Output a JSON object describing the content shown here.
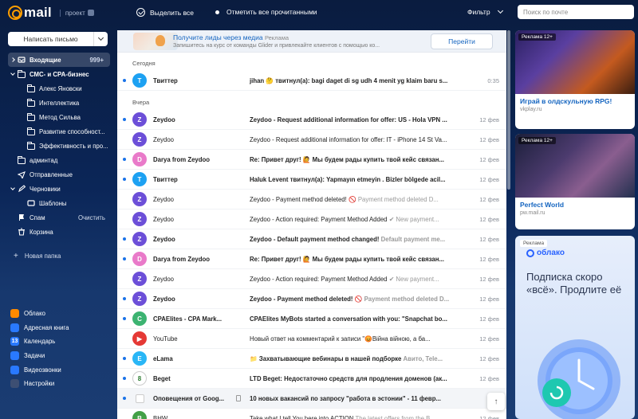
{
  "brand": {
    "word": "mail",
    "project_label": "проект"
  },
  "toolbar": {
    "select_all": "Выделить все",
    "mark_read": "Отметить все прочитанными",
    "filter": "Фильтр",
    "search_placeholder": "Поиск по почте"
  },
  "sidebar": {
    "compose": "Написать письмо",
    "items": [
      {
        "label": "Входящие",
        "count": "999+",
        "level": 0,
        "icon": "inbox-icon",
        "active": true,
        "arrow": "right"
      },
      {
        "label": "СМС- и CPA-бизнес",
        "level": 0,
        "icon": "folder-icon",
        "arrow": "down"
      },
      {
        "label": "Алекс Яновски",
        "level": 1,
        "icon": "folder-icon"
      },
      {
        "label": "Интеллектика",
        "level": 1,
        "icon": "folder-icon"
      },
      {
        "label": "Метод Сильва",
        "level": 1,
        "icon": "folder-icon"
      },
      {
        "label": "Развитие способност...",
        "level": 1,
        "icon": "folder-icon"
      },
      {
        "label": "Эффективность и про...",
        "level": 1,
        "icon": "folder-icon"
      },
      {
        "label": "админтад",
        "level": 0,
        "icon": "folder-icon"
      },
      {
        "label": "Отправленные",
        "level": 0,
        "icon": "sent-icon"
      },
      {
        "label": "Черновики",
        "level": 0,
        "icon": "draft-icon",
        "arrow": "down"
      },
      {
        "label": "Шаблоны",
        "level": 1,
        "icon": "template-icon"
      },
      {
        "label": "Спам",
        "level": 0,
        "icon": "spam-icon",
        "action": "Очистить"
      },
      {
        "label": "Корзина",
        "level": 0,
        "icon": "trash-icon"
      }
    ],
    "new_folder": "Новая папка",
    "apps": [
      {
        "label": "Облако",
        "color": "#ff8a00",
        "icon": "cloud-icon"
      },
      {
        "label": "Адресная книга",
        "color": "#2979ff",
        "icon": "contacts-icon"
      },
      {
        "label": "Календарь",
        "color": "#2979ff",
        "icon": "calendar-icon",
        "glyph": "13"
      },
      {
        "label": "Задачи",
        "color": "#2979ff",
        "icon": "tasks-icon"
      },
      {
        "label": "Видеозвонки",
        "color": "#2979ff",
        "icon": "video-icon"
      },
      {
        "label": "Настройки",
        "color": "#3d4f73",
        "icon": "gear-icon"
      }
    ]
  },
  "ad_banner": {
    "title": "Получите лиды через медиа",
    "tag": "Реклама",
    "text": "Запишитесь на курс от команды Glider и привлекайте клиентов с помощью ко...",
    "button": "Перейти"
  },
  "groups": {
    "today": "Сегодня",
    "yesterday": "Вчера"
  },
  "emails_today": [
    {
      "sender": "Твиттер",
      "subject": "jihan 🤔 твитнул(а): bagi daget di sg udh 4 menit yg klaim baru s...",
      "date": "0:35",
      "unread": true,
      "avatar": "T",
      "color": "#1da1f2"
    }
  ],
  "emails": [
    {
      "sender": "Zeydoo",
      "subject": "Zeydoo - Request additional information for offer: US - Hola VPN ...",
      "date": "12 фев",
      "unread": true,
      "avatar": "Z",
      "color": "#6c4fd8"
    },
    {
      "sender": "Zeydoo",
      "subject": "Zeydoo - Request additional information for offer: IT - iPhone 14 St Va...",
      "date": "12 фев",
      "unread": false,
      "avatar": "Z",
      "color": "#6c4fd8"
    },
    {
      "sender": "Darya from Zeydoo",
      "subject": "Re: Привет друг! 🙋 Мы будем рады купить твой кейс связан...",
      "date": "12 фев",
      "unread": true,
      "avatar": "D",
      "color": "#e97ac9"
    },
    {
      "sender": "Твиттер",
      "subject": "Haluk Levent твитнул(а): Yapmayın etmeyin . Bizler bölgede acil...",
      "date": "12 фев",
      "unread": true,
      "avatar": "T",
      "color": "#1da1f2"
    },
    {
      "sender": "Zeydoo",
      "subject": "Zeydoo - Payment method deleted!",
      "preview": "🚫 Payment method deleted D...",
      "date": "12 фев",
      "unread": false,
      "avatar": "Z",
      "color": "#6c4fd8"
    },
    {
      "sender": "Zeydoo",
      "subject": "Zeydoo - Action required: Payment Method Added",
      "preview": "✔ New payment...",
      "date": "12 фев",
      "unread": false,
      "avatar": "Z",
      "color": "#6c4fd8"
    },
    {
      "sender": "Zeydoo",
      "subject": "Zeydoo - Default payment method changed!",
      "preview": "Default payment me...",
      "date": "12 фев",
      "unread": true,
      "avatar": "Z",
      "color": "#6c4fd8"
    },
    {
      "sender": "Darya from Zeydoo",
      "subject": "Re: Привет друг! 🙋 Мы будем рады купить твой кейс связан...",
      "date": "12 фев",
      "unread": true,
      "avatar": "D",
      "color": "#e97ac9"
    },
    {
      "sender": "Zeydoo",
      "subject": "Zeydoo - Action required: Payment Method Added",
      "preview": "✔ New payment...",
      "date": "12 фев",
      "unread": false,
      "avatar": "Z",
      "color": "#6c4fd8"
    },
    {
      "sender": "Zeydoo",
      "subject": "Zeydoo - Payment method deleted!",
      "preview": "🚫 Payment method deleted D...",
      "date": "12 фев",
      "unread": true,
      "avatar": "Z",
      "color": "#6c4fd8"
    },
    {
      "sender": "CPAElites - CPA Mark...",
      "subject": "CPAElites MyBots started a conversation with you: \"Snapchat bo...",
      "date": "12 фев",
      "unread": true,
      "avatar": "C",
      "color": "#3cb371"
    },
    {
      "sender": "YouTube",
      "subject": "Новый ответ на комментарий к записи \"😡Війна війною, а ба...",
      "date": "12 фев",
      "unread": false,
      "avatar": "▶",
      "color": "#e53935"
    },
    {
      "sender": "eLama",
      "subject": "📁 Захватывающие вебинары в нашей подборке",
      "preview": "Авито, Tele...",
      "date": "12 фев",
      "unread": true,
      "avatar": "E",
      "color": "#29b6f6"
    },
    {
      "sender": "Beget",
      "subject": "LTD Beget: Недостаточно средств для продления доменов (ак...",
      "date": "12 фев",
      "unread": true,
      "avatar": "8",
      "color": "#ffffff"
    },
    {
      "sender": "Оповещения от Goog...",
      "subject": "10 новых вакансий по запросу \"работа в эстонии\" - 11 февр...",
      "date": "",
      "unread": true,
      "avatar": "",
      "color": "#ffffff",
      "selected": true
    },
    {
      "sender": "BHW",
      "subject": "Take what I tell You here into ACTION",
      "preview": "The latest offers from the B...",
      "date": "12 фев",
      "unread": false,
      "avatar": "B",
      "color": "#43a047"
    }
  ],
  "right_ads": [
    {
      "tag": "Реклама 12+",
      "title": "Играй в олдскульную RPG!",
      "domain": "vkplay.ru"
    },
    {
      "tag": "Реклама 12+",
      "title": "Perfect World",
      "domain": "pw.mail.ru"
    }
  ],
  "cloud_ad": {
    "tag": "Реклама",
    "brand": "облако",
    "text": "Подписка скоро «всё». Продлите её"
  }
}
